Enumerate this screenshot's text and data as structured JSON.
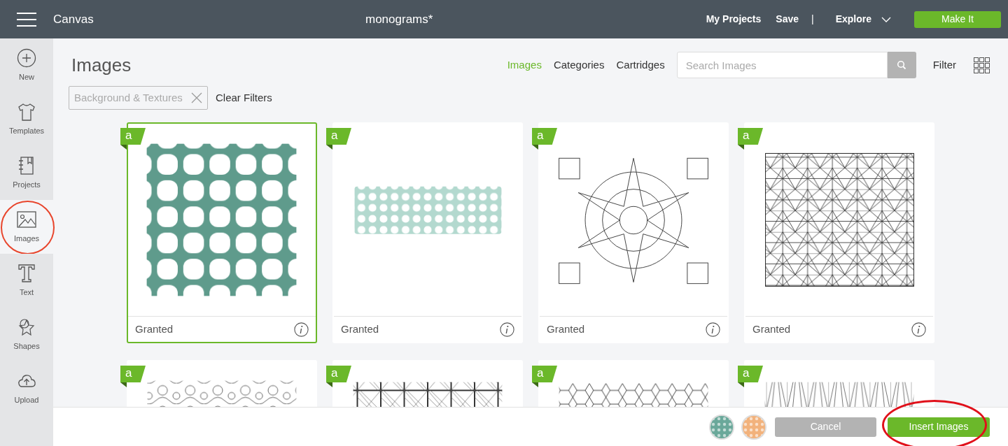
{
  "header": {
    "app": "Canvas",
    "project": "monograms*",
    "links": [
      "My Projects",
      "Save"
    ],
    "separator": "|",
    "explore": "Explore",
    "make_it": "Make It"
  },
  "sidebar": {
    "items": [
      {
        "label": "New",
        "selected": false,
        "circled": false
      },
      {
        "label": "Templates",
        "selected": false,
        "circled": false
      },
      {
        "label": "Projects",
        "selected": false,
        "circled": false
      },
      {
        "label": "Images",
        "selected": true,
        "circled": true
      },
      {
        "label": "Text",
        "selected": false,
        "circled": false
      },
      {
        "label": "Shapes",
        "selected": false,
        "circled": false
      },
      {
        "label": "Upload",
        "selected": false,
        "circled": false
      }
    ]
  },
  "page_title": "Images",
  "tabs": [
    {
      "label": "Images",
      "selected": true
    },
    {
      "label": "Categories",
      "selected": false
    },
    {
      "label": "Cartridges",
      "selected": false
    }
  ],
  "search": {
    "placeholder": "Search Images"
  },
  "filter": "Filter",
  "active_filter": "Background & Textures",
  "clear_filters": "Clear Filters",
  "cards": [
    {
      "kind": "quatrefoil",
      "badge": "a",
      "label": "Granted",
      "selected": true
    },
    {
      "kind": "petals",
      "badge": "a",
      "label": "Granted",
      "selected": false
    },
    {
      "kind": "medallion",
      "badge": "a",
      "label": "Granted",
      "selected": false
    },
    {
      "kind": "star-lattice",
      "badge": "a",
      "label": "Granted",
      "selected": false
    },
    {
      "kind": "ornament",
      "badge": "a",
      "selected": false
    },
    {
      "kind": "fence",
      "badge": "a",
      "selected": false
    },
    {
      "kind": "hexagons",
      "badge": "a",
      "selected": false
    },
    {
      "kind": "truss",
      "badge": "a",
      "selected": false
    }
  ],
  "tray": [
    {
      "color": "#6aa89a"
    },
    {
      "color": "#f2b27c"
    }
  ],
  "cancel": "Cancel",
  "insert": {
    "label": "Insert Images",
    "circled": true
  }
}
